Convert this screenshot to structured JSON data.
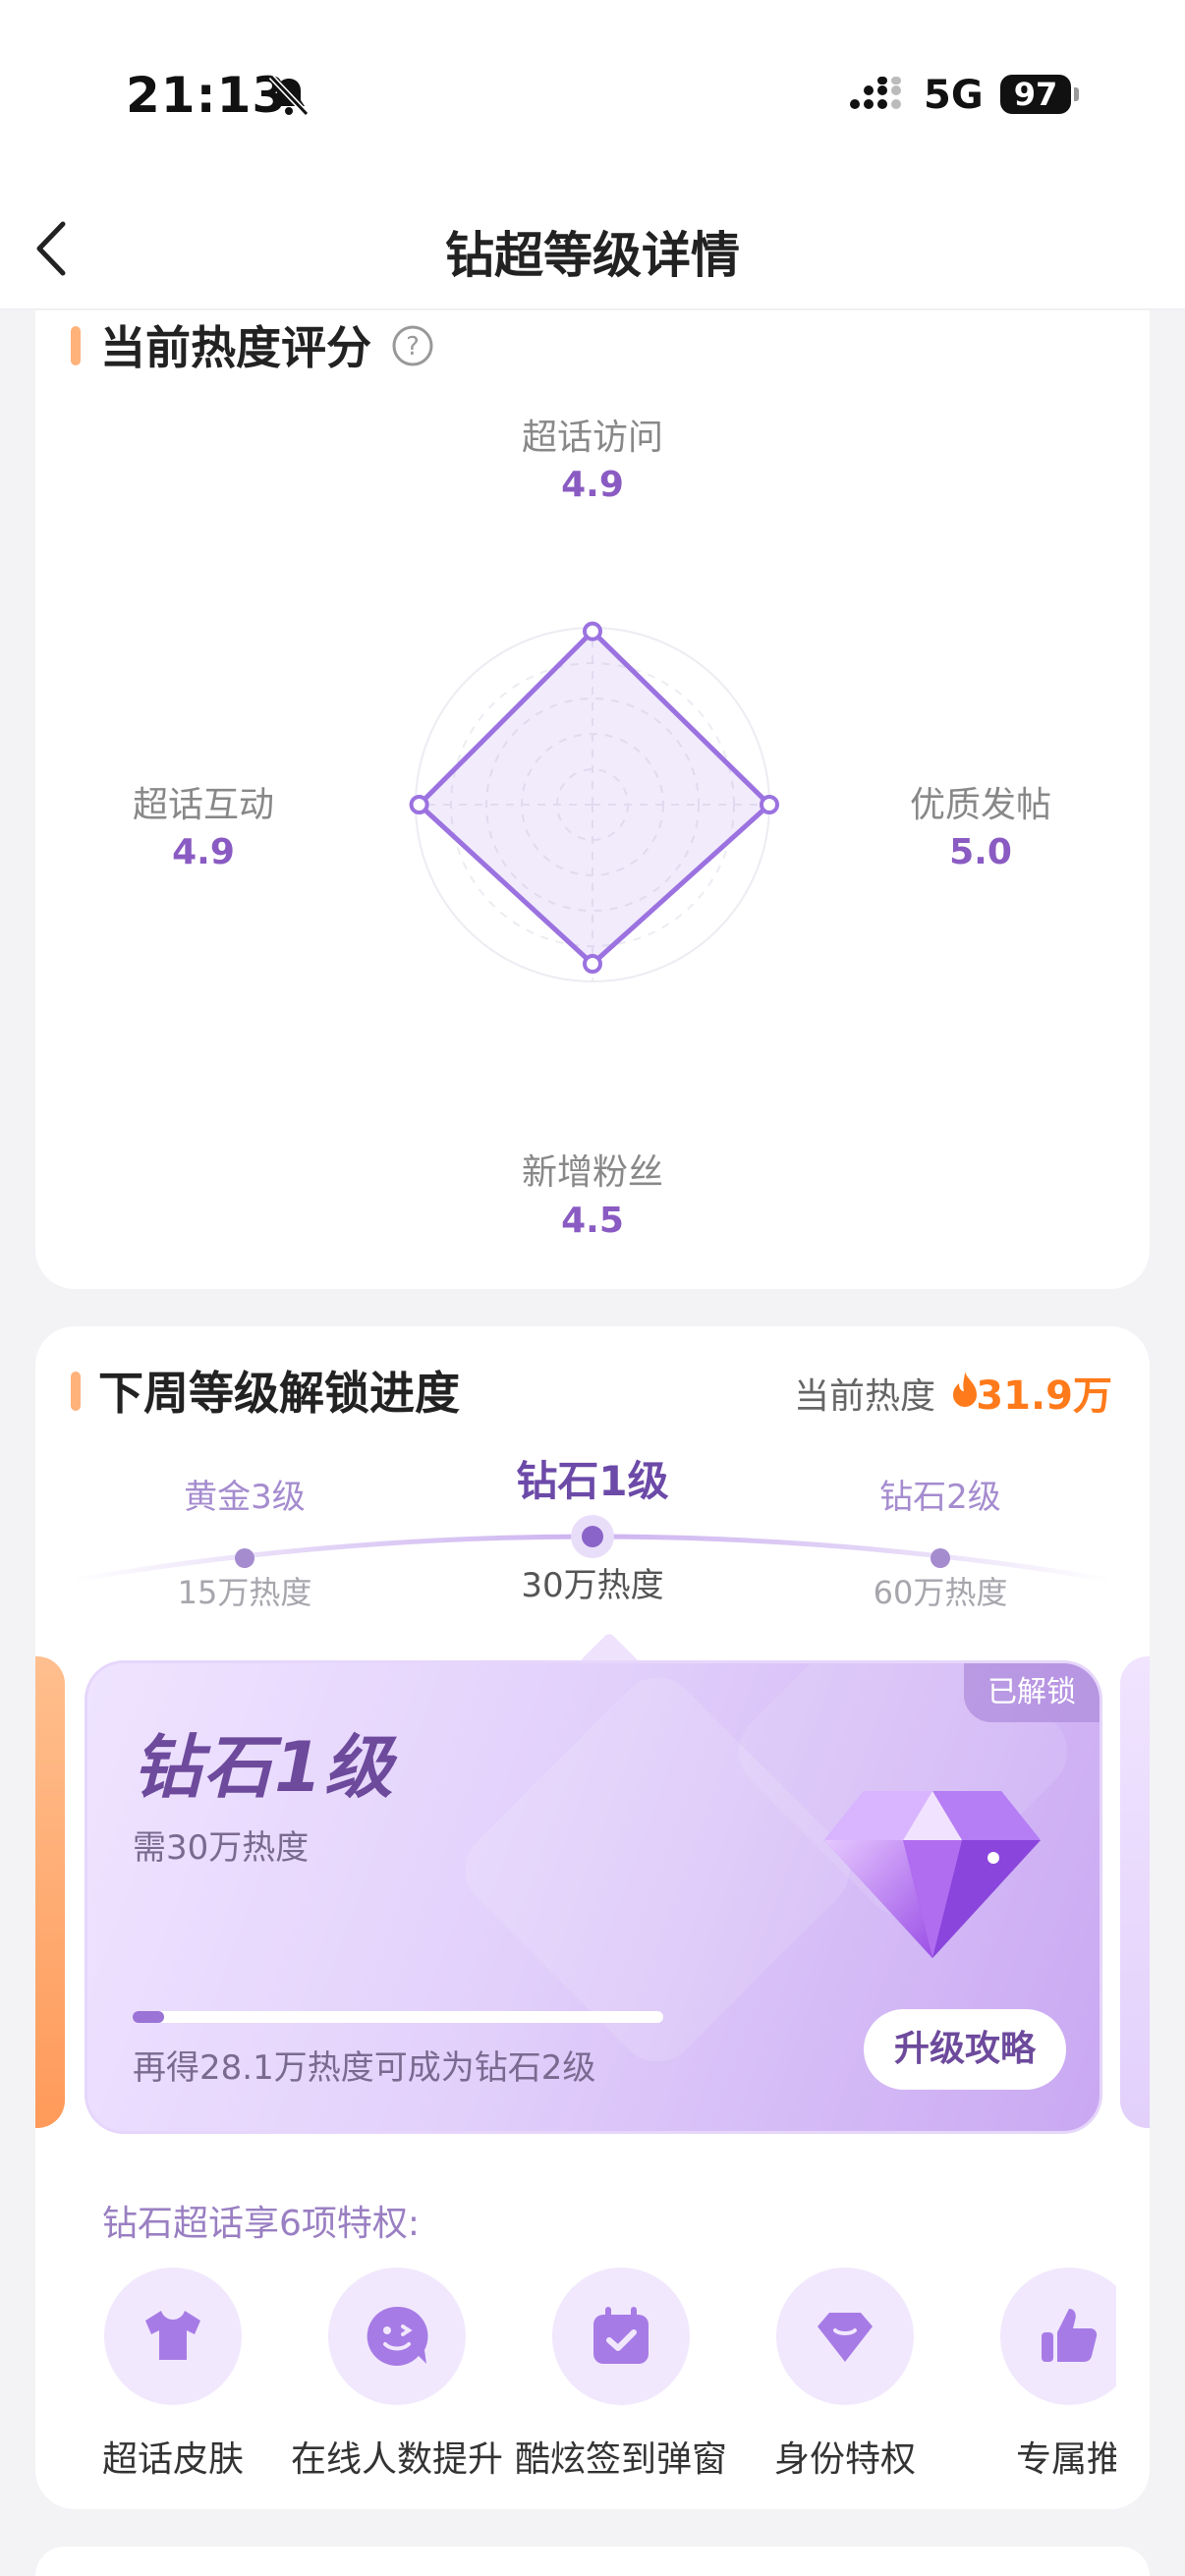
{
  "status_bar": {
    "time": "21:13",
    "network": "5G",
    "battery": "97"
  },
  "nav": {
    "title": "钻超等级详情"
  },
  "score": {
    "title": "当前热度评分",
    "axes": [
      {
        "label": "超话访问",
        "value": "4.9"
      },
      {
        "label": "优质发帖",
        "value": "5.0"
      },
      {
        "label": "新增粉丝",
        "value": "4.5"
      },
      {
        "label": "超话互动",
        "value": "4.9"
      }
    ],
    "max": 5
  },
  "unlock": {
    "title": "下周等级解锁进度",
    "heat_label": "当前热度",
    "heat_value": "31.9万",
    "levels": [
      {
        "name": "黄金3级",
        "heat": "15万热度"
      },
      {
        "name": "钻石1级",
        "heat": "30万热度"
      },
      {
        "name": "钻石2级",
        "heat": "60万热度"
      }
    ],
    "card": {
      "badge": "已解锁",
      "name": "钻石1级",
      "requirement": "需30万热度",
      "progress_text": "再得28.1万热度可成为钻石2级",
      "progress_fraction": 0.06,
      "button": "升级攻略"
    },
    "perks_title": "钻石超话享6项特权:",
    "perks": [
      {
        "label": "超话皮肤",
        "icon": "shirt-icon"
      },
      {
        "label": "在线人数提升",
        "icon": "smile-icon"
      },
      {
        "label": "酷炫签到弹窗",
        "icon": "calendar-check-icon"
      },
      {
        "label": "身份特权",
        "icon": "badge-icon"
      },
      {
        "label": "专属推",
        "icon": "thumb-up-icon"
      }
    ]
  },
  "colors": {
    "accent": "#8a5bc2",
    "heat": "#ff7a1a",
    "section_bar": "#ffb27a"
  }
}
